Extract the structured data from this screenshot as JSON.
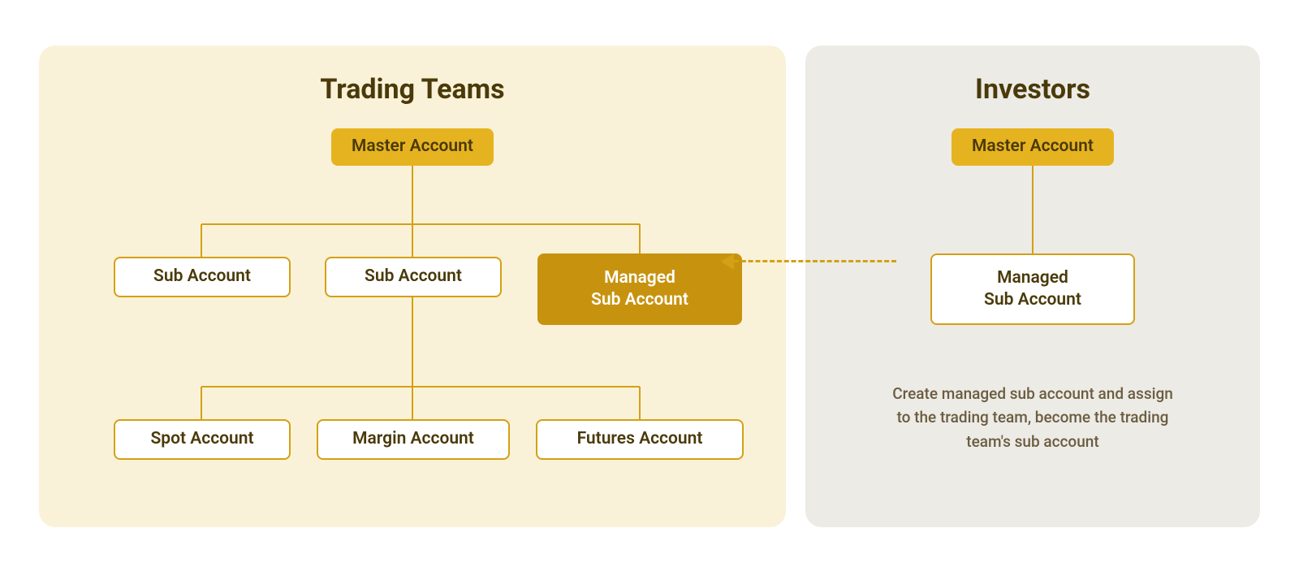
{
  "trading": {
    "title": "Trading Teams",
    "master": "Master Account",
    "sub1": "Sub Account",
    "sub2": "Sub Account",
    "managed": "Managed\nSub Account",
    "spot": "Spot Account",
    "margin": "Margin Account",
    "futures": "Futures Account"
  },
  "investors": {
    "title": "Investors",
    "master": "Master Account",
    "managed": "Managed\nSub Account",
    "desc": "Create managed sub account and assign to the trading team, become the trading team's sub account"
  }
}
